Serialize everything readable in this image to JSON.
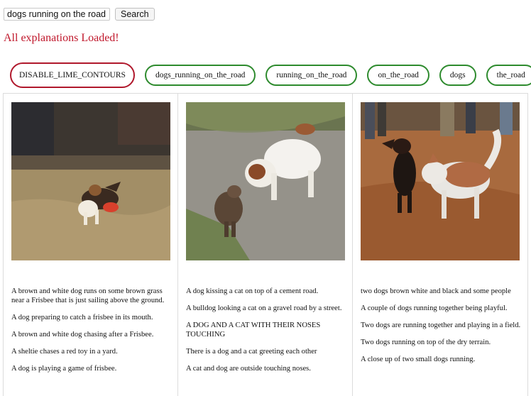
{
  "search": {
    "value": "dogs running on the road",
    "button_label": "Search"
  },
  "status": "All explanations Loaded!",
  "filters": [
    {
      "label": "DISABLE_LIME_CONTOURS",
      "active": true
    },
    {
      "label": "dogs_running_on_the_road",
      "active": false
    },
    {
      "label": "running_on_the_road",
      "active": false
    },
    {
      "label": "on_the_road",
      "active": false
    },
    {
      "label": "dogs",
      "active": false
    },
    {
      "label": "the_road",
      "active": false
    }
  ],
  "results": [
    {
      "captions": [
        "A brown and white dog runs on some brown grass near a Frisbee that is just sailing above the ground.",
        "A dog preparing to catch a frisbee in its mouth.",
        "A brown and white dog chasing after a Frisbee.",
        "A sheltie chases a red toy in a yard.",
        "A dog is playing a game of frisbee."
      ]
    },
    {
      "captions": [
        "A dog kissing a cat on top of a cement road.",
        "A bulldog looking a cat on a gravel road by a street.",
        "A DOG AND A CAT WITH THEIR NOSES TOUCHING",
        "There is a dog and a cat greeting each other",
        "A cat and dog are outside touching noses."
      ]
    },
    {
      "captions": [
        "two dogs brown white and black and some people",
        "A couple of dogs running together being playful.",
        "Two dogs are running together and playing in a field.",
        "Two dogs running on top of the dry terrain.",
        "A close up of two small dogs running."
      ]
    }
  ]
}
